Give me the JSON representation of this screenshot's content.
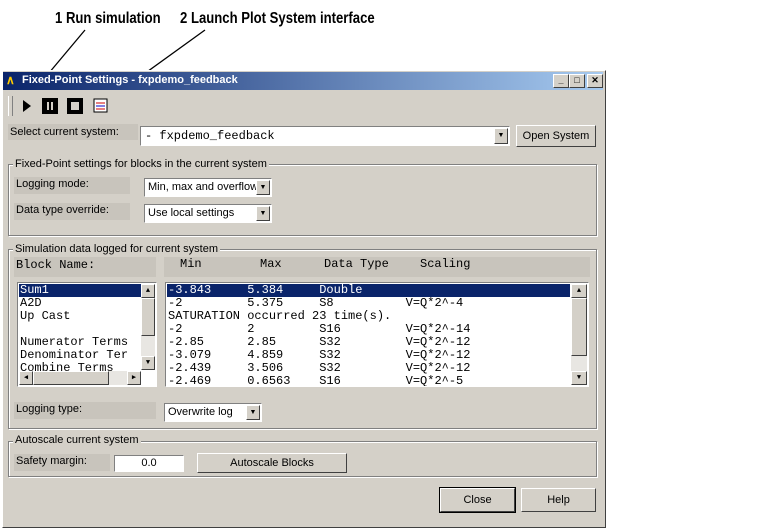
{
  "annotations": {
    "run": "1 Run simulation",
    "plot": "2 Launch Plot System interface"
  },
  "window": {
    "title": "Fixed-Point Settings - fxpdemo_feedback",
    "controls": [
      "minimize-icon",
      "maximize-icon",
      "close-icon"
    ]
  },
  "toolbar": {
    "icons": [
      "run-icon",
      "pause-icon",
      "stop-icon",
      "plot-system-icon"
    ]
  },
  "system": {
    "label": "Select current system:",
    "value": "- fxpdemo_feedback",
    "open_button": "Open System"
  },
  "fixed_point": {
    "group_label": "Fixed-Point settings for blocks in the current system",
    "logging_mode_label": "Logging mode:",
    "logging_mode_value": "Min, max and overflow",
    "override_label": "Data type override:",
    "override_value": "Use local settings"
  },
  "simulation": {
    "group_label": "Simulation data logged for current system",
    "block_name_header": "Block Name:",
    "headers": {
      "min": "Min",
      "max": "Max",
      "dtype": "Data Type",
      "scaling": "Scaling"
    },
    "blocks": [
      "Sum1",
      "A2D",
      "Up Cast",
      "",
      "Numerator Terms",
      "Denominator Ter",
      "Combine Terms"
    ],
    "data_rows": [
      "-3.843     5.384     Double",
      "-2         5.375     S8          V=Q*2^-4",
      "SATURATION occurred 23 time(s).",
      "-2         2         S16         V=Q*2^-14",
      "-2.85      2.85      S32         V=Q*2^-12",
      "-3.079     4.859     S32         V=Q*2^-12",
      "-2.439     3.506     S32         V=Q*2^-12",
      "-2.469     0.6563    S16         V=Q*2^-5"
    ],
    "logging_type_label": "Logging type:",
    "logging_type_value": "Overwrite log"
  },
  "autoscale": {
    "group_label": "Autoscale current system",
    "safety_label": "Safety margin:",
    "safety_value": "0.0",
    "button": "Autoscale Blocks"
  },
  "footer": {
    "close": "Close",
    "help": "Help"
  }
}
